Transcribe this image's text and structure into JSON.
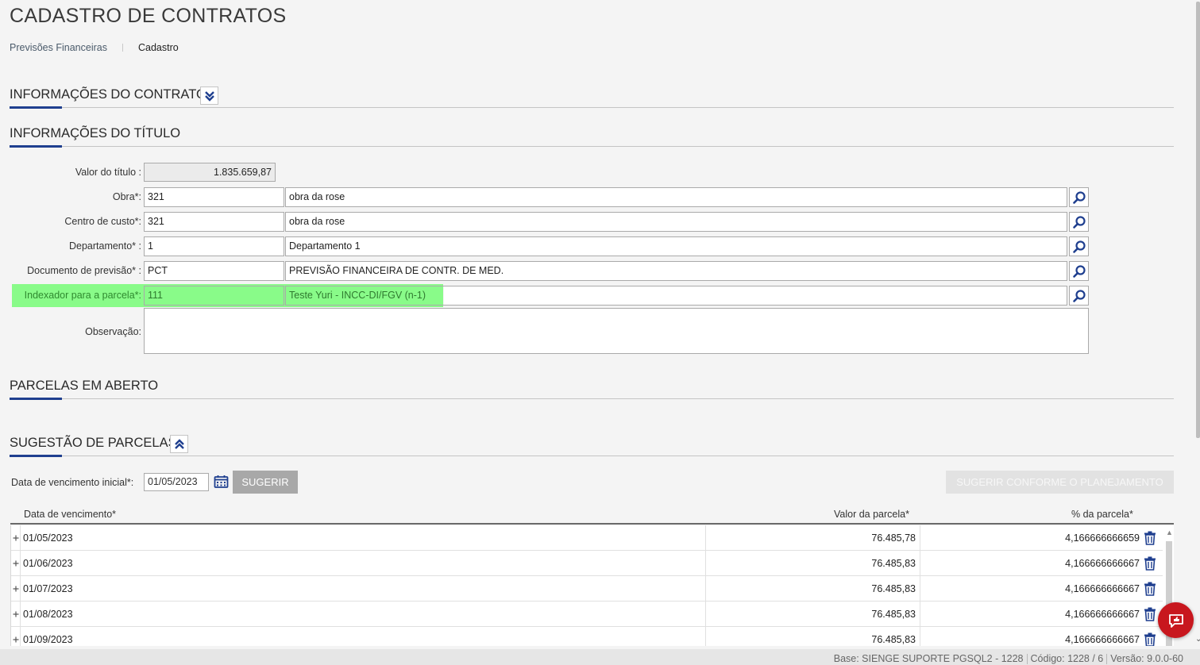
{
  "page": {
    "title": "CADASTRO DE CONTRATOS"
  },
  "breadcrumb": {
    "link": "Previsões Financeiras",
    "current": "Cadastro"
  },
  "sections": {
    "contract_info": "INFORMAÇÕES DO CONTRATO",
    "title_info": "INFORMAÇÕES DO TÍTULO",
    "open_installments": "PARCELAS EM ABERTO",
    "installment_suggestion": "SUGESTÃO DE PARCELAS"
  },
  "form": {
    "valor_titulo": {
      "label": "Valor do título :",
      "value": "1.835.659,87"
    },
    "obra": {
      "label": "Obra*:",
      "code": "321",
      "description": "obra da rose"
    },
    "centro_custo": {
      "label": "Centro de custo*:",
      "code": "321",
      "description": "obra da rose"
    },
    "departamento": {
      "label": "Departamento* :",
      "code": "1",
      "description": "Departamento 1"
    },
    "documento": {
      "label": "Documento de previsão* :",
      "code": "PCT",
      "description": "PREVISÃO FINANCEIRA DE CONTR. DE MED."
    },
    "indexador": {
      "label": "Indexador para a parcela*:",
      "code": "111",
      "description": "Teste Yuri -  INCC-DI/FGV (n-1)"
    },
    "observacao": {
      "label": "Observação:",
      "value": ""
    }
  },
  "suggestion": {
    "date_label": "Data de vencimento inicial*:",
    "date_value": "01/05/2023",
    "suggest_button": "SUGERIR",
    "plan_button": "SUGERIR CONFORME O PLANEJAMENTO"
  },
  "grid": {
    "columns": [
      "Data de vencimento*",
      "Valor da parcela*",
      "% da parcela*"
    ],
    "rows": [
      {
        "date": "01/05/2023",
        "value": "76.485,78",
        "percent": "4,166666666659"
      },
      {
        "date": "01/06/2023",
        "value": "76.485,83",
        "percent": "4,166666666667"
      },
      {
        "date": "01/07/2023",
        "value": "76.485,83",
        "percent": "4,166666666667"
      },
      {
        "date": "01/08/2023",
        "value": "76.485,83",
        "percent": "4,166666666667"
      },
      {
        "date": "01/09/2023",
        "value": "76.485,83",
        "percent": "4,166666666667"
      }
    ]
  },
  "footer": {
    "base": "Base: SIENGE SUPORTE PGSQL2 - 1228",
    "codigo": "Código: 1228 / 6",
    "versao": "Versão: 9.0.0-60"
  },
  "colors": {
    "accent": "#1f3f8f",
    "highlight": "#50ff50",
    "chat_button": "#c8171e"
  },
  "icons": [
    "chevron-double-down-icon",
    "chevron-double-up-icon",
    "search-icon",
    "calendar-icon",
    "trash-icon",
    "expand-plus-icon",
    "chat-icon"
  ]
}
